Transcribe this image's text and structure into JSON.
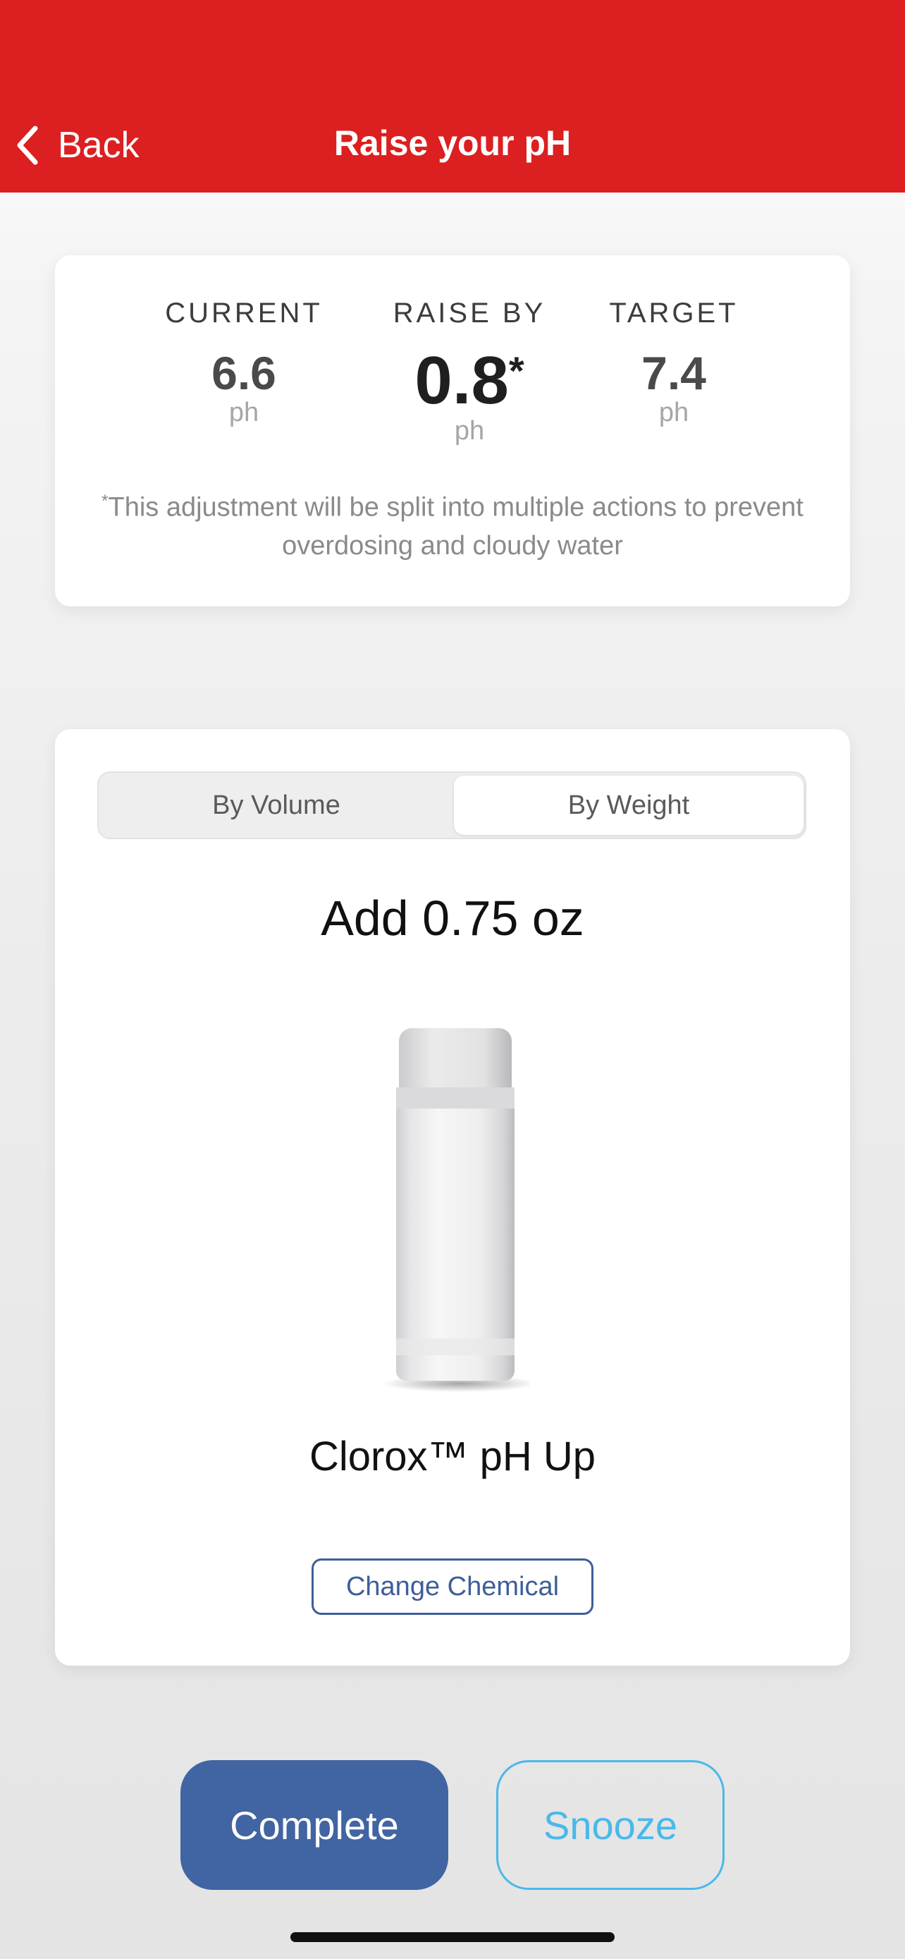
{
  "header": {
    "back_label": "Back",
    "title": "Raise your pH",
    "background_color": "#dc1f20"
  },
  "summary": {
    "current": {
      "label": "CURRENT",
      "value": "6.6",
      "unit": "ph"
    },
    "raise_by": {
      "label": "RAISE BY",
      "value": "0.8",
      "marker": "*",
      "unit": "ph"
    },
    "target": {
      "label": "TARGET",
      "value": "7.4",
      "unit": "ph"
    },
    "footnote_marker": "*",
    "footnote": "This adjustment will be split into multiple actions to prevent overdosing and cloudy water"
  },
  "dosage": {
    "tabs": [
      {
        "label": "By Volume",
        "selected": false
      },
      {
        "label": "By Weight",
        "selected": true
      }
    ],
    "instruction": "Add 0.75 oz",
    "product_name": "Clorox™ pH Up",
    "product_icon": "chemical-bottle",
    "change_label": "Change Chemical"
  },
  "actions": {
    "complete_label": "Complete",
    "snooze_label": "Snooze",
    "complete_color": "#4164a3",
    "snooze_color": "#4ab8ea"
  }
}
